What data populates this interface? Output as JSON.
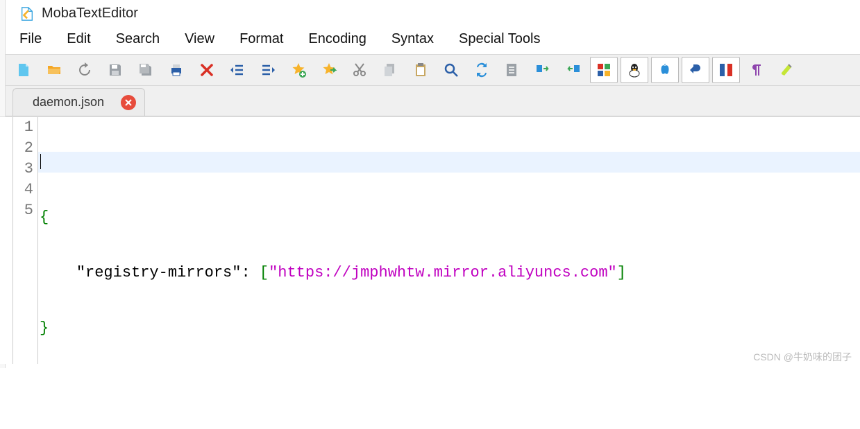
{
  "app": {
    "title": "MobaTextEditor"
  },
  "menu": {
    "file": "File",
    "edit": "Edit",
    "search": "Search",
    "view": "View",
    "format": "Format",
    "encoding": "Encoding",
    "syntax": "Syntax",
    "special": "Special Tools"
  },
  "tab": {
    "name": "daemon.json"
  },
  "gutter": {
    "l1": "1",
    "l2": "2",
    "l3": "3",
    "l4": "4",
    "l5": "5"
  },
  "code": {
    "line1": "",
    "line2_brace_open": "{",
    "line3_indent": "    ",
    "line3_key": "\"registry-mirrors\"",
    "line3_colon": ": ",
    "line3_lbracket": "[",
    "line3_string": "\"https://jmphwhtw.mirror.aliyuncs.com\"",
    "line3_rbracket": "]",
    "line4_brace_close": "}",
    "line5": ""
  },
  "watermark": "CSDN @牛奶味的团子",
  "colors": {
    "current_line_bg": "#eaf3ff",
    "brace": "#008000",
    "string": "#c000c0"
  }
}
